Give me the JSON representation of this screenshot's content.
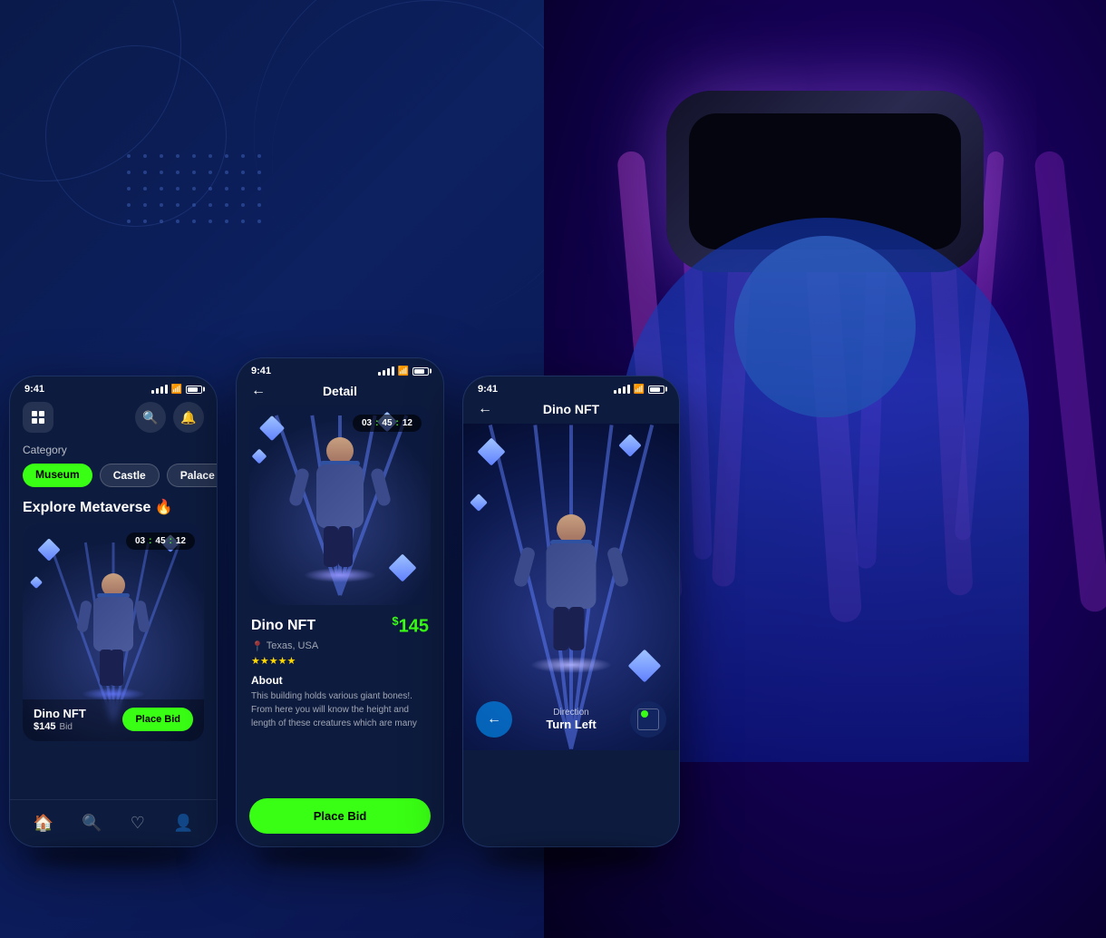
{
  "background": {
    "left_color_start": "#0a1a4a",
    "left_color_end": "#0a1550",
    "right_color": "#1a0a5e"
  },
  "phone1": {
    "status_time": "9:41",
    "header_icon": "grid-icon",
    "category_label": "Category",
    "pills": [
      {
        "label": "Museum",
        "active": true
      },
      {
        "label": "Castle",
        "active": false
      },
      {
        "label": "Palace",
        "active": false
      }
    ],
    "explore_title": "Explore Metaverse",
    "timer": {
      "h": "03",
      "m": "45",
      "s": "12"
    },
    "nft": {
      "name": "Dino NFT",
      "price": "$145",
      "bid_label": "Bid",
      "place_bid": "Place Bid"
    },
    "nav_items": [
      "home",
      "search",
      "heart",
      "user"
    ]
  },
  "phone2": {
    "status_time": "9:41",
    "title": "Detail",
    "timer": {
      "h": "03",
      "m": "45",
      "s": "12"
    },
    "nft": {
      "name": "Dino NFT",
      "price": "145",
      "price_symbol": "$",
      "location": "Texas, USA",
      "stars": 4.5,
      "about_label": "About",
      "about_text": "This building holds various giant bones!. From here you will know the height and length of these creatures which are many",
      "place_bid": "Place Bid"
    }
  },
  "phone3": {
    "status_time": "9:41",
    "title": "Dino NFT",
    "direction_label": "Direction",
    "direction_value": "Turn Left"
  }
}
